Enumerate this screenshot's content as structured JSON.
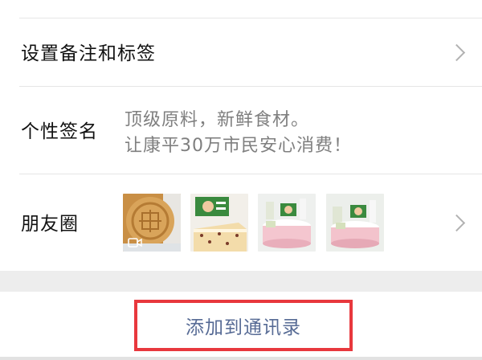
{
  "rows": {
    "remark": {
      "label": "设置备注和标签"
    },
    "signature": {
      "label": "个性签名",
      "lines": [
        "顶级原料，新鲜食材。",
        "让康平30万市民安心消费！"
      ]
    },
    "moments": {
      "label": "朋友圈",
      "thumbnails": [
        {
          "icon": "video-camera-icon",
          "has_video": true
        },
        {
          "icon": "",
          "has_video": false
        },
        {
          "icon": "",
          "has_video": false
        },
        {
          "icon": "",
          "has_video": false
        }
      ]
    }
  },
  "add_contact": {
    "label": "添加到通讯录"
  },
  "colors": {
    "link_blue": "#576b95",
    "highlight_red": "#e8383d",
    "secondary_text": "#7f7f7f",
    "page_background": "#ededed"
  }
}
